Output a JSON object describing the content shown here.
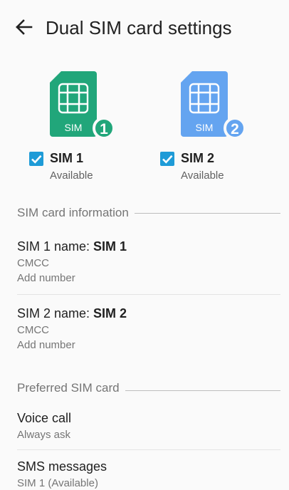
{
  "header": {
    "title": "Dual SIM card settings",
    "back_icon": "arrow-back-icon"
  },
  "sims": [
    {
      "name": "SIM 1",
      "status": "Available",
      "card_label": "SIM",
      "badge": "1",
      "color": "#21a67a",
      "checked": true
    },
    {
      "name": "SIM 2",
      "status": "Available",
      "card_label": "SIM",
      "badge": "2",
      "color": "#64a4f0",
      "checked": true
    }
  ],
  "check_color": "#1e9bd7",
  "sim_info": {
    "header": "SIM card information",
    "items": [
      {
        "name_prefix": "SIM 1 name: ",
        "name_value": "SIM 1",
        "carrier": "CMCC",
        "number": "Add number"
      },
      {
        "name_prefix": "SIM 2 name: ",
        "name_value": "SIM 2",
        "carrier": "CMCC",
        "number": "Add number"
      }
    ]
  },
  "preferred": {
    "header": "Preferred SIM card",
    "items": [
      {
        "title": "Voice call",
        "value": "Always ask"
      },
      {
        "title": "SMS messages",
        "value": "SIM 1 (Available)"
      }
    ]
  }
}
